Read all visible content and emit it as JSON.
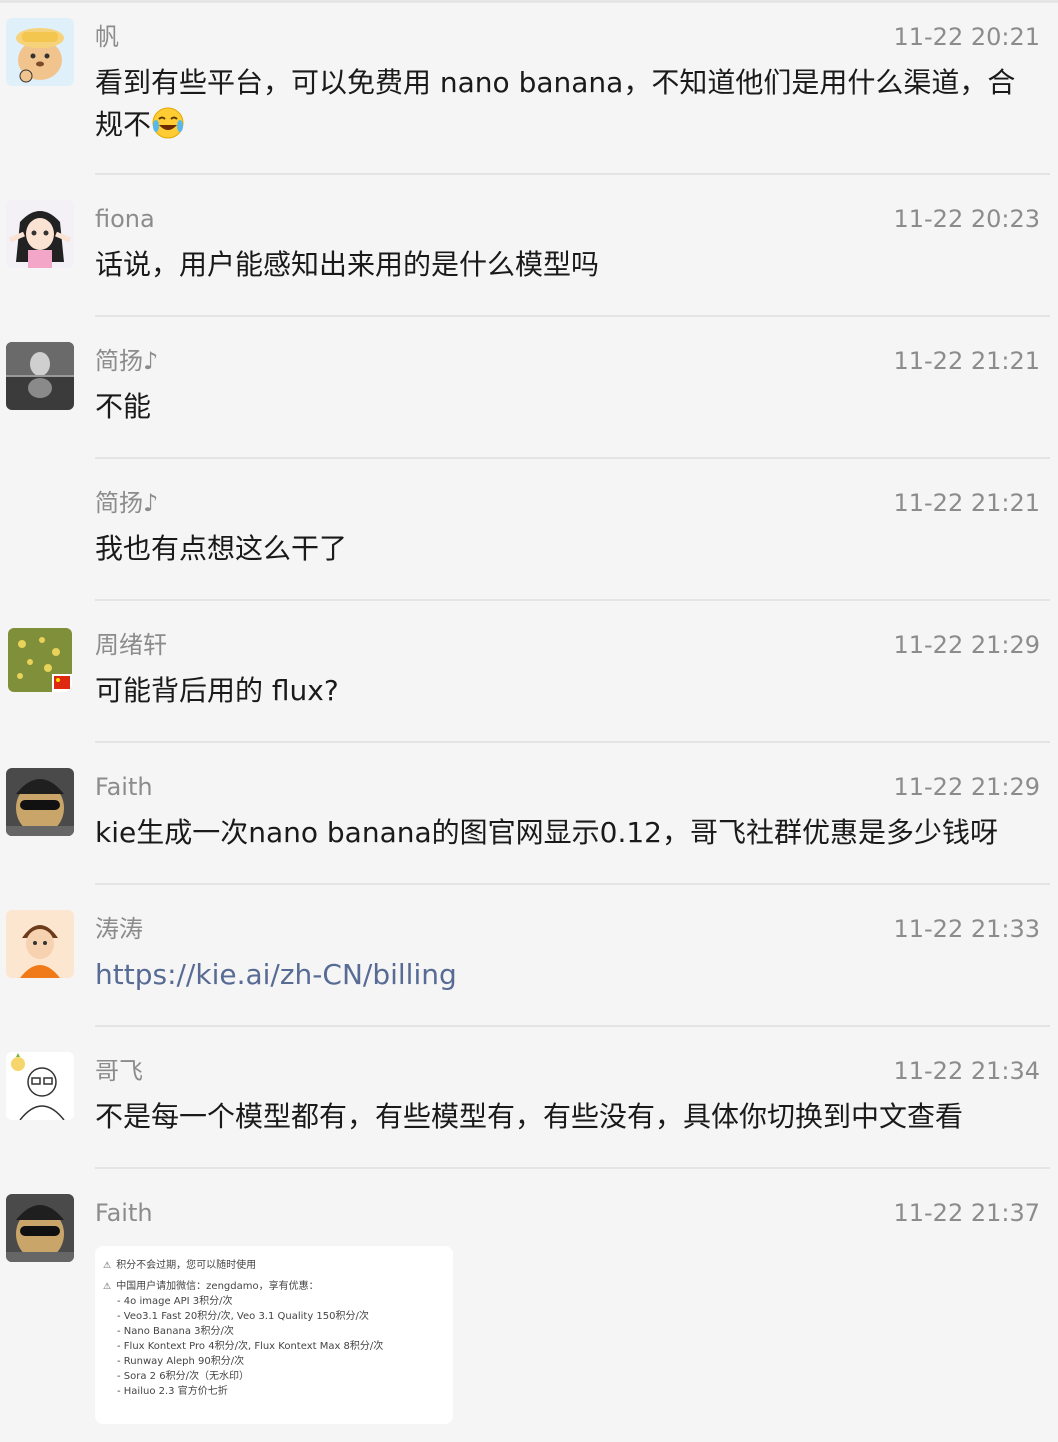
{
  "messages": [
    {
      "name": "帆",
      "time": "11-22 20:21",
      "text": "看到有些平台，可以免费用 nano banana，不知道他们是用什么渠道，合规不",
      "emoji": "tears-of-joy-emoji"
    },
    {
      "name": "fiona",
      "time": "11-22 20:23",
      "text": "话说，用户能感知出来用的是什么模型吗"
    },
    {
      "name": "简扬♪",
      "time": "11-22 21:21",
      "text": "不能"
    },
    {
      "name": "简扬♪",
      "time": "11-22 21:21",
      "text": "我也有点想这么干了"
    },
    {
      "name": "周绪轩",
      "time": "11-22 21:29",
      "text": "可能背后用的 flux?"
    },
    {
      "name": "Faith",
      "time": "11-22 21:29",
      "text": "kie生成一次nano banana的图官网显示0.12，哥飞社群优惠是多少钱呀"
    },
    {
      "name": "涛涛",
      "time": "11-22 21:33",
      "text": "https://kie.ai/zh-CN/billing",
      "link_color": "#576b95"
    },
    {
      "name": "哥飞",
      "time": "11-22 21:34",
      "text": "不是每一个模型都有，有些模型有，有些没有，具体你切换到中文查看"
    },
    {
      "name": "Faith",
      "time": "11-22 21:37",
      "image": {
        "line1": "积分不会过期，您可以随时使用",
        "line2": "中国用户请加微信：zengdamo，享有优惠：",
        "items": [
          "- 4o image API 3积分/次",
          "- Veo3.1 Fast 20积分/次, Veo 3.1 Quality 150积分/次",
          "- Nano Banana 3积分/次",
          "- Flux Kontext Pro 4积分/次, Flux Kontext Max 8积分/次",
          "- Runway Aleph 90积分/次",
          "- Sora 2 6积分/次（无水印）",
          "- Hailuo 2.3 官方价七折"
        ]
      }
    }
  ],
  "colors": {
    "background": "#f5f5f5",
    "meta_text": "#8c8c8c",
    "body_text": "#1a1a1a",
    "link": "#576b95"
  }
}
